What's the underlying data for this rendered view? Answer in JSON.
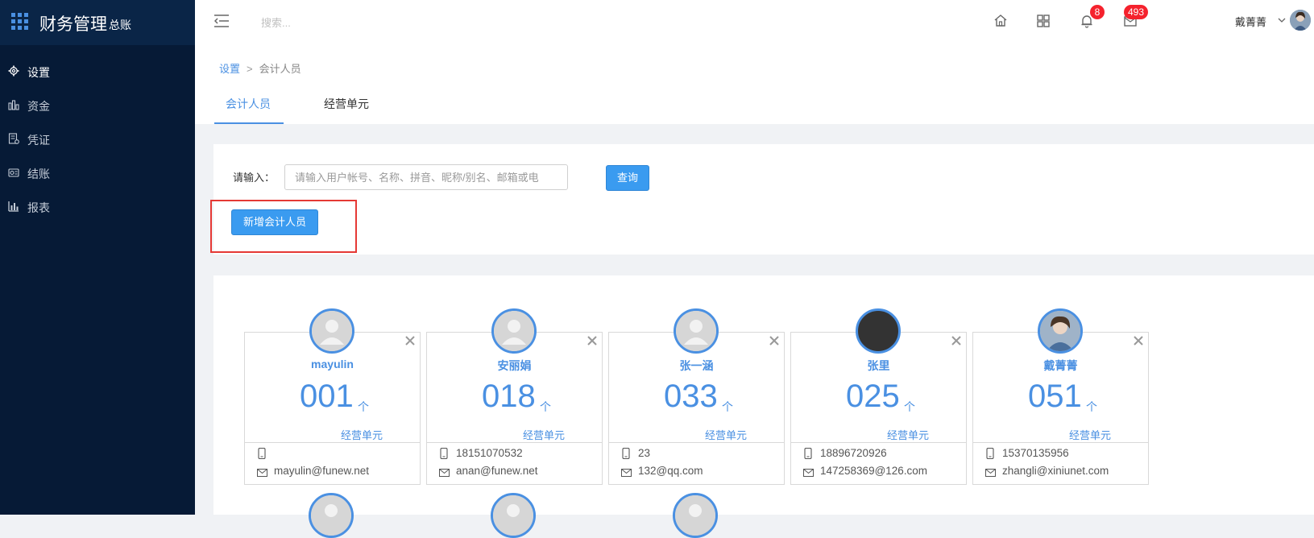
{
  "app": {
    "title": "财务管理",
    "subtitle": "总账"
  },
  "sidebar": {
    "items": [
      {
        "label": "设置",
        "icon": "gear-icon",
        "active": true
      },
      {
        "label": "资金",
        "icon": "fund-icon",
        "active": false
      },
      {
        "label": "凭证",
        "icon": "voucher-icon",
        "active": false
      },
      {
        "label": "结账",
        "icon": "closing-icon",
        "active": false
      },
      {
        "label": "报表",
        "icon": "report-icon",
        "active": false
      }
    ]
  },
  "header": {
    "search_placeholder": "搜索...",
    "notifications_count": "8",
    "messages_count": "493",
    "username": "戴菁菁"
  },
  "breadcrumb": {
    "root": "设置",
    "sep": ">",
    "current": "会计人员"
  },
  "tabs": [
    {
      "label": "会计人员",
      "active": true
    },
    {
      "label": "经营单元",
      "active": false
    }
  ],
  "filter": {
    "label": "请输入：",
    "placeholder": "请输入用户帐号、名称、拼音、昵称/别名、邮箱或电",
    "query_button": "查询",
    "add_button": "新增会计人员"
  },
  "cards": [
    {
      "name": "mayulin",
      "count": "001",
      "unit": "个",
      "biz_label": "经营单元",
      "phone": "",
      "email": "mayulin@funew.net",
      "avatar": "placeholder"
    },
    {
      "name": "安丽娟",
      "count": "018",
      "unit": "个",
      "biz_label": "经营单元",
      "phone": "18151070532",
      "email": "anan@funew.net",
      "avatar": "placeholder"
    },
    {
      "name": "张一涵",
      "count": "033",
      "unit": "个",
      "biz_label": "经营单元",
      "phone": "23",
      "email": "132@qq.com",
      "avatar": "placeholder"
    },
    {
      "name": "张里",
      "count": "025",
      "unit": "个",
      "biz_label": "经营单元",
      "phone": "18896720926",
      "email": "147258369@126.com",
      "avatar": "dark"
    },
    {
      "name": "戴菁菁",
      "count": "051",
      "unit": "个",
      "biz_label": "经营单元",
      "phone": "15370135956",
      "email": "zhangli@xiniunet.com",
      "avatar": "photo"
    }
  ],
  "colors": {
    "sidebar": "#061a36",
    "accent": "#4a90e2",
    "primary_button": "#3a9bf0",
    "badge": "#f5222d",
    "highlight": "#e53935"
  }
}
